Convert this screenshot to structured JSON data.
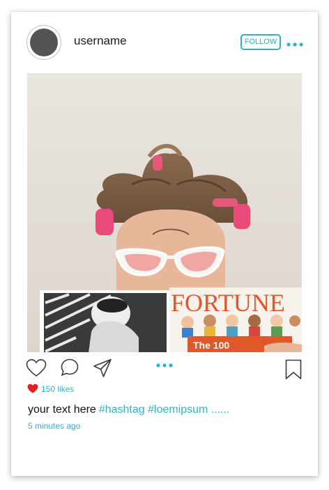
{
  "post": {
    "username": "username",
    "follow_label": "FOLLOW",
    "likes": "150 likes",
    "caption_text": "your text here",
    "hashtags": "#hashtag #loemipsum ......",
    "timestamp": "5 minutes ago"
  },
  "photo": {
    "magazine_title": "FORTUNE",
    "magazine_subtitle": "The 100"
  },
  "icons": {
    "like": "heart-icon",
    "comment": "comment-icon",
    "share": "send-icon",
    "more": "more-dots-icon",
    "save": "bookmark-icon",
    "liked": "filled-heart-icon"
  },
  "colors": {
    "accent": "#2bb4c9",
    "like_red": "#e02020",
    "avatar": "#545454"
  }
}
